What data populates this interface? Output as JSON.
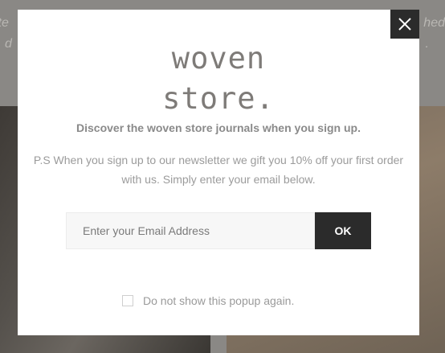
{
  "background": {
    "text_left_line1": "ite",
    "text_left_line2": "d",
    "text_right_line1": "hed",
    "text_right_line2": "."
  },
  "popup": {
    "logo_line1": "woven",
    "logo_line2": "store.",
    "headline": "Discover the woven store journals when you sign up.",
    "description": "P.S When you sign up to our newsletter we gift you 10% off your first order with us. Simply enter your email below.",
    "email_placeholder": "Enter your Email Address",
    "email_value": "",
    "submit_label": "OK",
    "dont_show_label": "Do not show this popup again.",
    "dont_show_checked": false,
    "close_icon": "close-icon"
  },
  "colors": {
    "overlay": "#8a8885",
    "modal_bg": "#ffffff",
    "dark_button": "#2b2b2b",
    "text_gray": "#8a8a8a"
  }
}
